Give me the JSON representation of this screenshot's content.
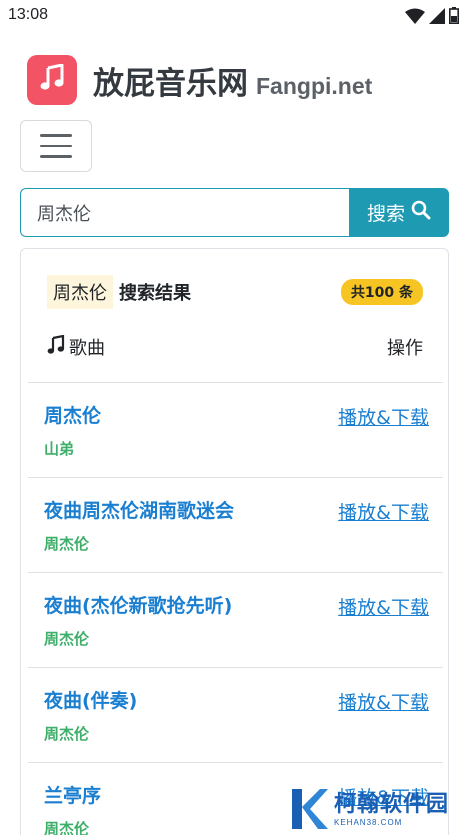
{
  "status_bar": {
    "time": "13:08"
  },
  "header": {
    "title_cn": "放屁音乐网",
    "title_en": "Fangpi.net"
  },
  "search": {
    "value": "周杰伦",
    "button_label": "搜索"
  },
  "results_card": {
    "query": "周杰伦",
    "heading": "搜索结果",
    "count_badge": "共100 条",
    "column_song": "歌曲",
    "column_ops": "操作",
    "items": [
      {
        "title": "周杰伦",
        "artist": "山弟",
        "action": "播放&下载"
      },
      {
        "title": "夜曲周杰伦湖南歌迷会",
        "artist": "周杰伦",
        "action": "播放&下载"
      },
      {
        "title": "夜曲(杰伦新歌抢先听)",
        "artist": "周杰伦",
        "action": "播放&下载"
      },
      {
        "title": "夜曲(伴奏)",
        "artist": "周杰伦",
        "action": "播放&下载"
      },
      {
        "title": "兰亭序",
        "artist": "周杰伦",
        "action": "播放&下载"
      }
    ]
  },
  "watermark": {
    "name": "柯翰软件园",
    "domain": "KEHAN38.COM"
  },
  "colors": {
    "accent": "#1f9ab3",
    "logo_bg": "#f25466",
    "link": "#1a7fd1",
    "artist": "#3fae6a",
    "badge": "#f6c423"
  },
  "icons": [
    "wifi-icon",
    "signal-icon",
    "battery-icon",
    "music-note-icon",
    "hamburger-icon",
    "search-icon",
    "music-note-icon"
  ]
}
